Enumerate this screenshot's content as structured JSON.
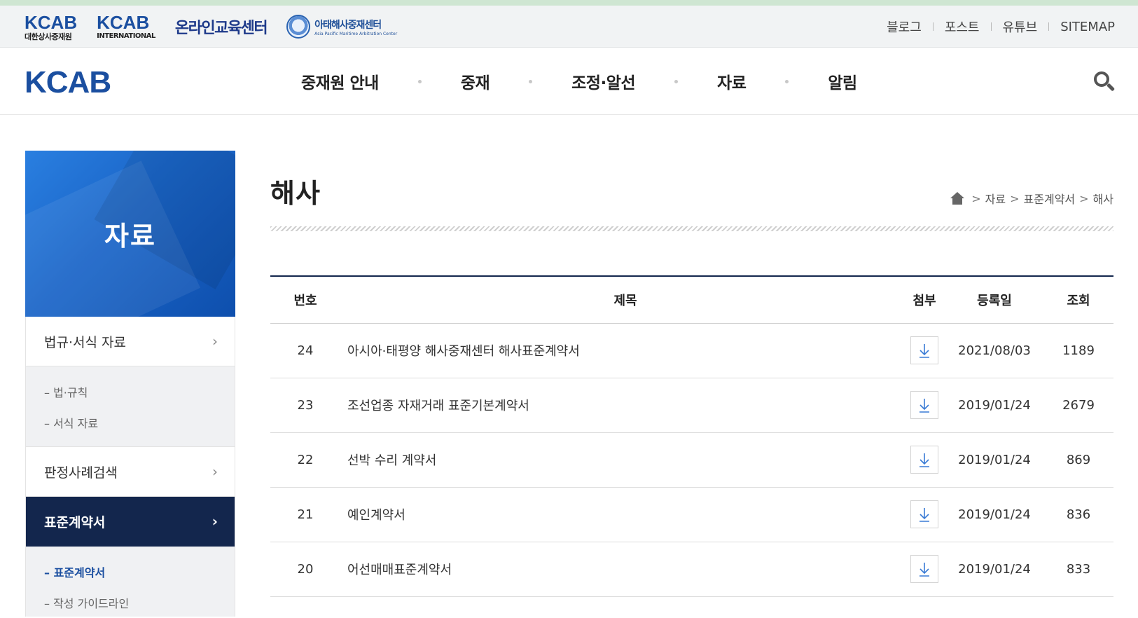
{
  "utility": {
    "logos": {
      "kcab_main": "KCAB",
      "kcab_main_sub": "대한상사중재원",
      "kcab_intl": "KCAB",
      "kcab_intl_sub": "INTERNATIONAL",
      "online": "온라인교육센터",
      "apmac": "아태해사중재센터",
      "apmac_sub": "Asia Pacific Maritime Arbitration Center"
    },
    "links": [
      "블로그",
      "포스트",
      "유튜브",
      "SITEMAP"
    ]
  },
  "header": {
    "logo": "KCAB",
    "nav": [
      "중재원 안내",
      "중재",
      "조정·알선",
      "자료",
      "알림"
    ]
  },
  "sidebar": {
    "title": "자료",
    "items": [
      {
        "label": "법규·서식 자료",
        "subs": [
          "– 법·규칙",
          "– 서식 자료"
        ]
      },
      {
        "label": "판정사례검색",
        "subs": []
      },
      {
        "label": "표준계약서",
        "subs": [
          "– 표준계약서",
          "– 작성 가이드라인"
        ]
      }
    ]
  },
  "page": {
    "title": "해사",
    "breadcrumb": [
      "자료",
      "표준계약서",
      "해사"
    ],
    "separator": ">"
  },
  "table": {
    "headers": {
      "no": "번호",
      "title": "제목",
      "attachment": "첨부",
      "date": "등록일",
      "views": "조회"
    },
    "rows": [
      {
        "no": "24",
        "title": "아시아·태평양 해사중재센터 해사표준계약서",
        "date": "2021/08/03",
        "views": "1189"
      },
      {
        "no": "23",
        "title": "조선업종 자재거래 표준기본계약서",
        "date": "2019/01/24",
        "views": "2679"
      },
      {
        "no": "22",
        "title": "선박 수리 계약서",
        "date": "2019/01/24",
        "views": "869"
      },
      {
        "no": "21",
        "title": "예인계약서",
        "date": "2019/01/24",
        "views": "836"
      },
      {
        "no": "20",
        "title": "어선매매표준계약서",
        "date": "2019/01/24",
        "views": "833"
      }
    ]
  },
  "icons": {
    "search": "search-icon",
    "home": "home-icon",
    "download": "download-icon",
    "chevron": "chevron-right-icon"
  },
  "colors": {
    "brand_blue": "#1b4fa0",
    "navy": "#13264d",
    "download_icon": "#3a7bd5"
  }
}
